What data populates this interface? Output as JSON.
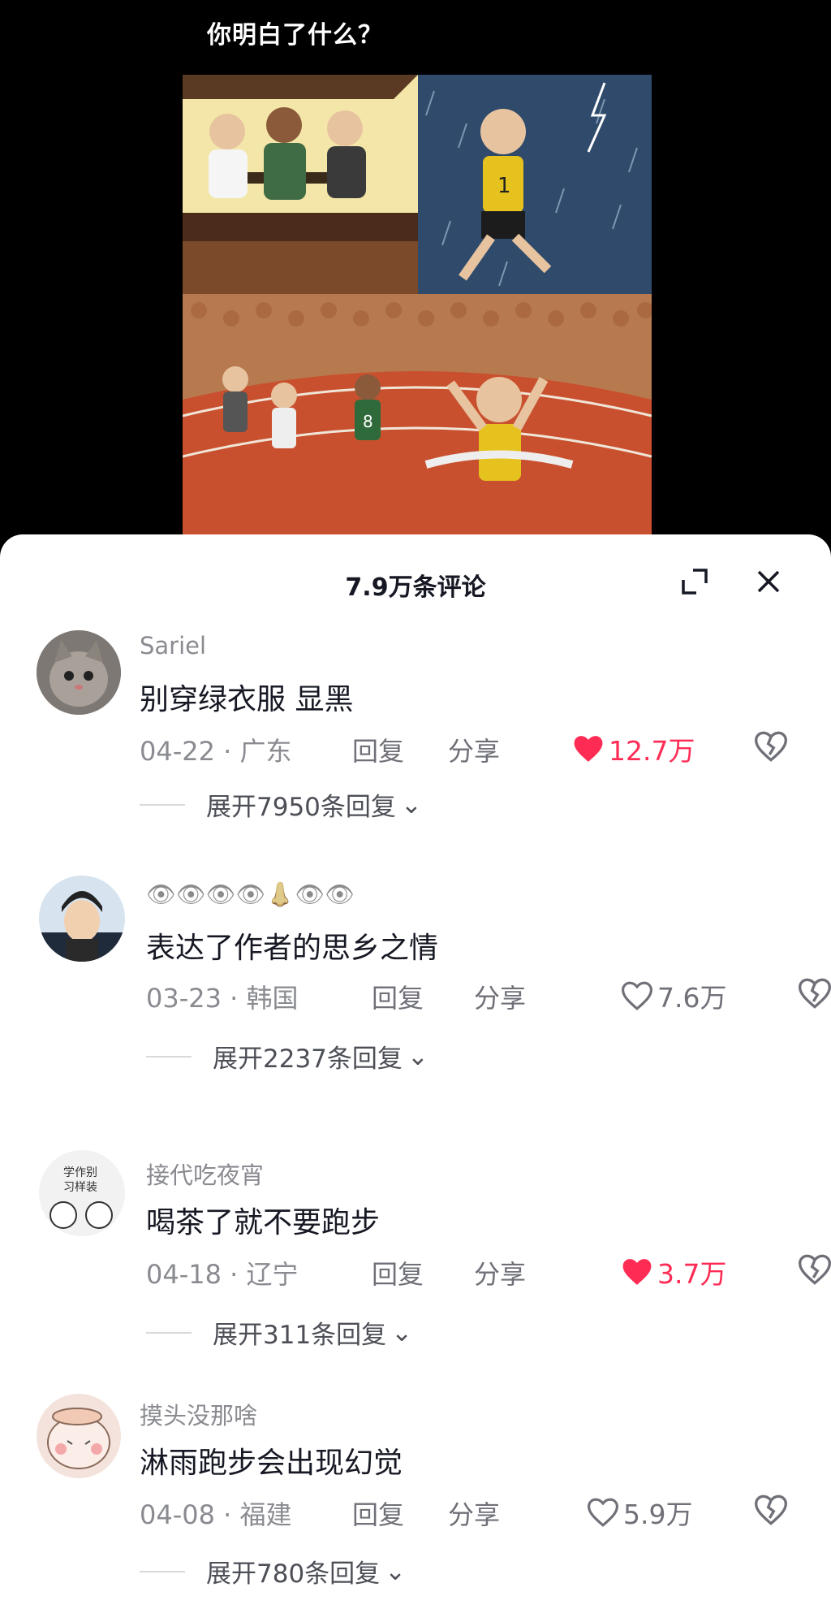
{
  "video": {
    "title": "你明白了什么？"
  },
  "comments_panel": {
    "title": "7.9万条评论"
  },
  "comments": [
    {
      "username": "Sariel",
      "content": "别穿绿衣服 显黑",
      "date_location": "04-22 · 广东",
      "reply_label": "回复",
      "share_label": "分享",
      "likes": "12.7万",
      "liked": true,
      "expand_label": "展开7950条回复"
    },
    {
      "username": "👁👁👁👁👃👁👁",
      "content": "表达了作者的思乡之情",
      "date_location": "03-23 · 韩国",
      "reply_label": "回复",
      "share_label": "分享",
      "likes": "7.6万",
      "liked": false,
      "expand_label": "展开2237条回复"
    },
    {
      "username": "接代吃夜宵",
      "content": "喝茶了就不要跑步",
      "date_location": "04-18 · 辽宁",
      "reply_label": "回复",
      "share_label": "分享",
      "likes": "3.7万",
      "liked": true,
      "expand_label": "展开311条回复"
    },
    {
      "username": "摸头没那啥",
      "content": "淋雨跑步会出现幻觉",
      "date_location": "04-08 · 福建",
      "reply_label": "回复",
      "share_label": "分享",
      "likes": "5.9万",
      "liked": false,
      "expand_label": "展开780条回复"
    }
  ],
  "colors": {
    "accent_like": "#fe2c55",
    "text_primary": "#161823",
    "text_secondary": "#8a8b91"
  }
}
